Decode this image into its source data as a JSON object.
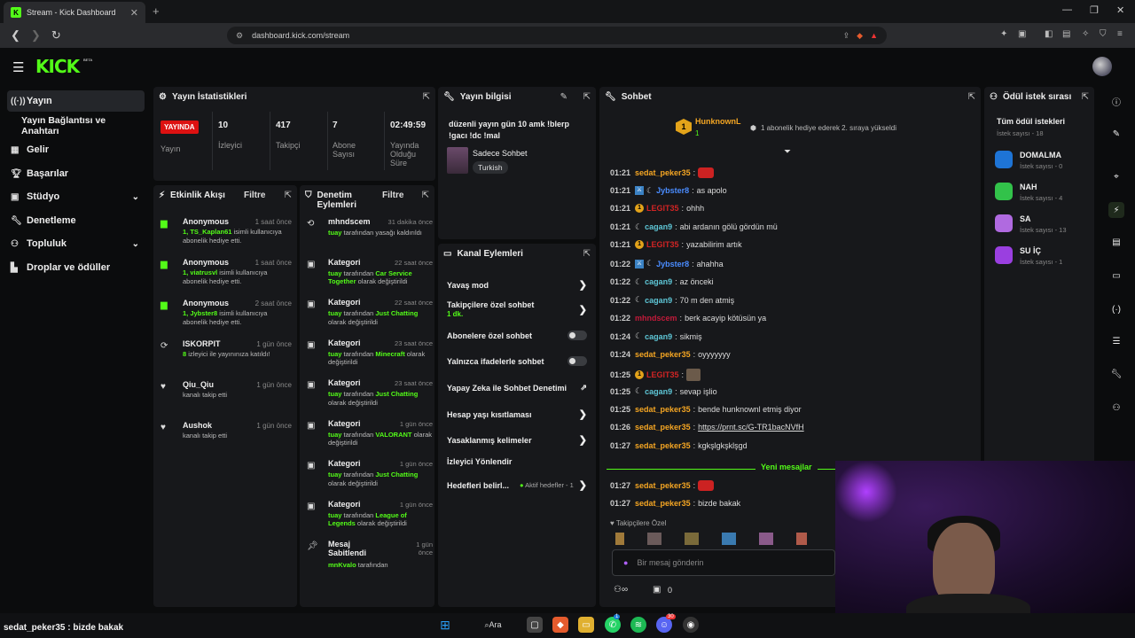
{
  "browser": {
    "tab_title": "Stream - Kick Dashboard",
    "url": "dashboard.kick.com/stream",
    "favicon": "K"
  },
  "app": {
    "logo": "KICK",
    "beta": "BETA"
  },
  "sidebar": {
    "items": [
      {
        "label": "Yayın",
        "icon": "radio-icon"
      },
      {
        "label": "Yayın Bağlantısı ve Anahtarı",
        "icon": ""
      },
      {
        "label": "Gelir",
        "icon": "revenue-icon"
      },
      {
        "label": "Başarılar",
        "icon": "trophy-icon"
      },
      {
        "label": "Stüdyo",
        "icon": "studio-icon"
      },
      {
        "label": "Denetleme",
        "icon": "wrench-icon"
      },
      {
        "label": "Topluluk",
        "icon": "community-icon"
      },
      {
        "label": "Droplar ve ödüller",
        "icon": "drops-icon"
      }
    ]
  },
  "stats": {
    "title": "Yayın İstatistikleri",
    "live_label": "YAYINDA",
    "live_sub": "Yayın",
    "viewers": "10",
    "viewers_label": "İzleyici",
    "followers": "417",
    "followers_label": "Takipçi",
    "subs": "7",
    "subs_label": "Abone Sayısı",
    "duration": "02:49:59",
    "duration_label": "Yayında Olduğu Süre"
  },
  "activity": {
    "title": "Etkinlik Akışı",
    "filter": "Filtre",
    "items": [
      {
        "name": "Anonymous",
        "time": "1 saat önce",
        "pre": "1, ",
        "user": "TS_Kaplan61",
        "post": " isimli kullanıcıya abonelik hediye etti."
      },
      {
        "name": "Anonymous",
        "time": "1 saat önce",
        "pre": "1, ",
        "user": "viatrusvl",
        "post": " isimli kullanıcıya abonelik hediye etti."
      },
      {
        "name": "Anonymous",
        "time": "2 saat önce",
        "pre": "1, ",
        "user": "Jybster8",
        "post": " isimli kullanıcıya abonelik hediye etti."
      },
      {
        "name": "ISKORPIT",
        "time": "1 gün önce",
        "pre": "",
        "user": "8",
        "post": " izleyici ile yayınınıza katıldı!"
      },
      {
        "name": "Qiu_Qiu",
        "time": "1 gün önce",
        "pre": "",
        "user": "",
        "post": "kanalı takip etti"
      },
      {
        "name": "Aushok",
        "time": "1 gün önce",
        "pre": "",
        "user": "",
        "post": "kanalı takip etti"
      }
    ]
  },
  "moderation": {
    "title": "Denetim Eylemleri",
    "filter": "Filtre",
    "items": [
      {
        "name": "mhndscem",
        "time": "31 dakika önce",
        "by": "tuay",
        "mid": " tarafından yasağı kaldırıldı",
        "val": "",
        "end": ""
      },
      {
        "name": "Kategori",
        "time": "22 saat önce",
        "by": "tuay",
        "mid": " tarafından ",
        "val": "Car Service Together",
        "end": " olarak değiştirildi"
      },
      {
        "name": "Kategori",
        "time": "22 saat önce",
        "by": "tuay",
        "mid": " tarafından ",
        "val": "Just Chatting",
        "end": " olarak değiştirildi"
      },
      {
        "name": "Kategori",
        "time": "23 saat önce",
        "by": "tuay",
        "mid": " tarafından ",
        "val": "Minecraft",
        "end": " olarak değiştirildi"
      },
      {
        "name": "Kategori",
        "time": "23 saat önce",
        "by": "tuay",
        "mid": " tarafından ",
        "val": "Just Chatting",
        "end": " olarak değiştirildi"
      },
      {
        "name": "Kategori",
        "time": "1 gün önce",
        "by": "tuay",
        "mid": " tarafından ",
        "val": "VALORANT",
        "end": " olarak değiştirildi"
      },
      {
        "name": "Kategori",
        "time": "1 gün önce",
        "by": "tuay",
        "mid": " tarafından ",
        "val": "Just Chatting",
        "end": " olarak değiştirildi"
      },
      {
        "name": "Kategori",
        "time": "1 gün önce",
        "by": "tuay",
        "mid": " tarafından ",
        "val": "League of Legends",
        "end": " olarak değiştirildi"
      },
      {
        "name": "Mesaj Sabitlendi",
        "time": "1 gün önce",
        "by": "mnKvalo",
        "mid": " tarafından",
        "val": "",
        "end": ""
      }
    ]
  },
  "info": {
    "title": "Yayın bilgisi",
    "stream_title": "düzenli yayın gün 10 amk !blerp !gacı !dc !mal",
    "category": "Sadece Sohbet",
    "language": "Turkish"
  },
  "channel": {
    "title": "Kanal Eylemleri",
    "rows": [
      {
        "label": "Yavaş mod",
        "type": "chevron",
        "sub": ""
      },
      {
        "label": "Takipçilere özel sohbet",
        "type": "chevron",
        "sub": "1 dk."
      },
      {
        "label": "Abonelere özel sohbet",
        "type": "toggle",
        "sub": ""
      },
      {
        "label": "Yalnızca ifadelerle sohbet",
        "type": "toggle",
        "sub": ""
      },
      {
        "label": "Yapay Zeka ile Sohbet Denetimi",
        "type": "external",
        "sub": ""
      },
      {
        "label": "Hesap yaşı kısıtlaması",
        "type": "chevron",
        "sub": ""
      },
      {
        "label": "Yasaklanmış kelimeler",
        "type": "chevron",
        "sub": ""
      },
      {
        "label": "İzleyici Yönlendir",
        "type": "none",
        "sub": ""
      },
      {
        "label": "Hedefleri belirl...",
        "type": "chevron",
        "sub": "Aktif hedefler - 1"
      }
    ]
  },
  "chat": {
    "title": "Sohbet",
    "pinned_user": "HunknownL",
    "pinned_count": "1",
    "pinned_text": "1 abonelik hediye ederek 2. sıraya yükseldi",
    "new_messages": "Yeni mesajlar",
    "followers_only": "Takipçilere Özel",
    "input_placeholder": "Bir mesaj gönderin",
    "kick_count": "0",
    "messages": [
      {
        "time": "01:21",
        "user": "sedat_peker35",
        "color": "#f5a623",
        "badges": "",
        "text": "",
        "emote": "red"
      },
      {
        "time": "01:21",
        "user": "Jybster8",
        "color": "#4a8cff",
        "badges": "bm",
        "text": "as apolo",
        "emote": ""
      },
      {
        "time": "01:21",
        "user": "LEGIT35",
        "color": "#d12424",
        "badges": "o",
        "text": "ohhh",
        "emote": ""
      },
      {
        "time": "01:21",
        "user": "cagan9",
        "color": "#5ec6d6",
        "badges": "m",
        "text": "abi ardanın gölü gördün mü",
        "emote": ""
      },
      {
        "time": "01:21",
        "user": "LEGIT35",
        "color": "#d12424",
        "badges": "o",
        "text": "yazabilirim artık",
        "emote": ""
      },
      {
        "time": "01:22",
        "user": "Jybster8",
        "color": "#4a8cff",
        "badges": "bm",
        "text": "ahahha",
        "emote": ""
      },
      {
        "time": "01:22",
        "user": "cagan9",
        "color": "#5ec6d6",
        "badges": "m",
        "text": "az önceki",
        "emote": ""
      },
      {
        "time": "01:22",
        "user": "cagan9",
        "color": "#5ec6d6",
        "badges": "m",
        "text": "70 m den atmiş",
        "emote": ""
      },
      {
        "time": "01:22",
        "user": "mhndscem",
        "color": "#c21a3a",
        "badges": "",
        "text": "berk acayip kötüsün ya",
        "emote": ""
      },
      {
        "time": "01:24",
        "user": "cagan9",
        "color": "#5ec6d6",
        "badges": "m",
        "text": "sikmiş",
        "emote": ""
      },
      {
        "time": "01:24",
        "user": "sedat_peker35",
        "color": "#f5a623",
        "badges": "",
        "text": "oyyyyyyy",
        "emote": ""
      },
      {
        "time": "01:25",
        "user": "LEGIT35",
        "color": "#d12424",
        "badges": "o",
        "text": "",
        "emote": "pic"
      },
      {
        "time": "01:25",
        "user": "cagan9",
        "color": "#5ec6d6",
        "badges": "m",
        "text": "sevap işlio",
        "emote": ""
      },
      {
        "time": "01:25",
        "user": "sedat_peker35",
        "color": "#f5a623",
        "badges": "",
        "text": "bende hunknownl etmiş diyor",
        "emote": ""
      },
      {
        "time": "01:26",
        "user": "sedat_peker35",
        "color": "#f5a623",
        "badges": "",
        "text": "https://prnt.sc/G-TR1bacNVfH",
        "emote": ""
      },
      {
        "time": "01:27",
        "user": "sedat_peker35",
        "color": "#f5a623",
        "badges": "",
        "text": "kgkşlgkşklşgd",
        "emote": ""
      }
    ],
    "new_msgs": [
      {
        "time": "01:27",
        "user": "sedat_peker35",
        "color": "#f5a623",
        "text": "",
        "emote": "red"
      },
      {
        "time": "01:27",
        "user": "sedat_peker35",
        "color": "#f5a623",
        "text": "bizde bakak",
        "emote": ""
      }
    ]
  },
  "rewards": {
    "title": "Ödül istek sırası",
    "all_title": "Tüm ödül istekleri",
    "all_sub": "İstek sayısı - 18",
    "items": [
      {
        "label": "DOMALMA",
        "sub": "İstek sayısı - 0",
        "color": "#1e74d6"
      },
      {
        "label": "NAH",
        "sub": "İstek sayısı - 4",
        "color": "#32c24a"
      },
      {
        "label": "SA",
        "sub": "İstek sayısı - 13",
        "color": "#b06ae0"
      },
      {
        "label": "SU İÇ",
        "sub": "İstek sayısı - 1",
        "color": "#9a3fe0"
      }
    ]
  },
  "overlay": {
    "user": "sedat_peker35",
    "text": " : bizde bakak"
  },
  "taskbar": {
    "search": "Ara",
    "badge_whatsapp": "1",
    "badge_discord": "30"
  },
  "colors": {
    "accent": "#53fc18",
    "live": "#dd1111",
    "panel": "#17181b"
  }
}
